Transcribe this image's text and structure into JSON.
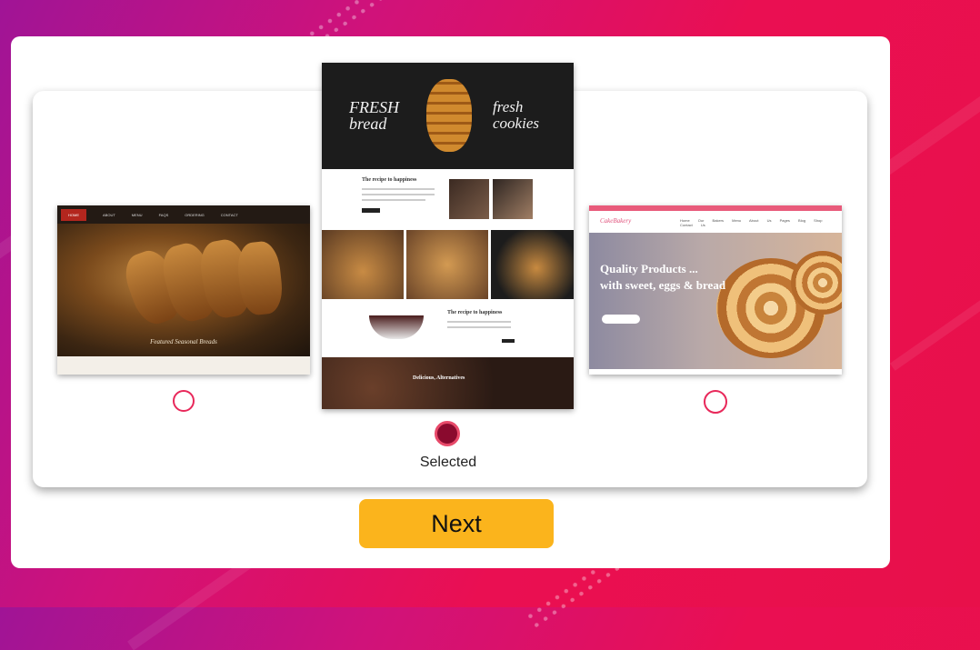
{
  "templates": [
    {
      "nav": [
        "HOME",
        "ABOUT",
        "MENU",
        "FAQS",
        "ORDERING",
        "CONTACT"
      ],
      "caption": "Featured Seasonal Breads",
      "selected": false
    },
    {
      "hero_left": "FRESH bread",
      "hero_right": "fresh cookies",
      "section1_title": "The recipe to happiness",
      "section2_title": "The recipe to happiness",
      "section3_title": "Delicious, Alternatives",
      "selected": true
    },
    {
      "logo": "CakeBakery",
      "nav": "Home Our Bakers Menu About Us Pages Blog Shop Contact Us",
      "headline_1": "Quality Products ...",
      "headline_2": "with sweet, eggs & bread",
      "selected": false
    }
  ],
  "selected_label": "Selected",
  "next_label": "Next",
  "colors": {
    "accent": "#fbb41c",
    "radio_border": "#e8285a",
    "radio_selected": "#8a0a2e"
  }
}
